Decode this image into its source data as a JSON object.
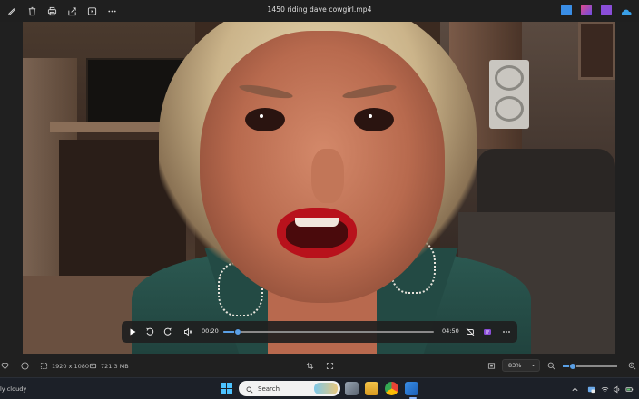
{
  "titlebar": {
    "title": "1450 riding dave cowgirl.mp4",
    "left_icons": [
      "edit-icon",
      "delete-icon",
      "print-icon",
      "share-icon",
      "slideshow-icon",
      "more-icon"
    ],
    "right_apps": [
      {
        "name": "photos-app-icon",
        "color": "#3a8ee6"
      },
      {
        "name": "designer-app-icon",
        "color": "#6a4ee6"
      },
      {
        "name": "clipchamp-app-icon",
        "color": "#8a4ed8"
      },
      {
        "name": "onedrive-icon",
        "color": "#3aa0e8"
      }
    ]
  },
  "player": {
    "current_time": "00:20",
    "duration": "04:50",
    "progress": 0.069,
    "accent": "#5aa0e6"
  },
  "statusbar": {
    "resolution": "1920 x 1080",
    "file_size": "721.3 MB",
    "zoom": "83%",
    "zoom_level": 0.18
  },
  "taskbar": {
    "weather": "ly cloudy",
    "search_label": "Search"
  }
}
